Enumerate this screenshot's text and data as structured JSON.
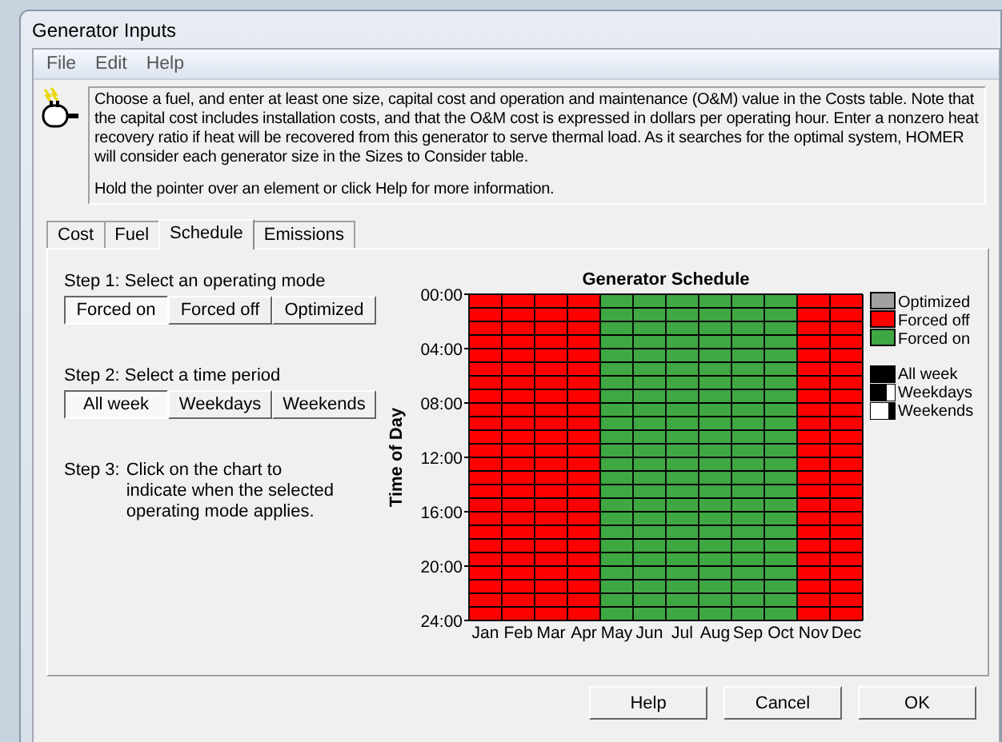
{
  "window": {
    "title": "Generator Inputs"
  },
  "menu": [
    "File",
    "Edit",
    "Help"
  ],
  "description": [
    "Choose a fuel, and enter at least one size, capital cost and operation and maintenance (O&M) value in the Costs table. Note that the capital cost includes installation costs, and that the O&M cost is expressed in dollars per operating hour. Enter a nonzero heat recovery ratio if heat will be recovered from this generator to serve thermal load. As it searches for the optimal system, HOMER will consider each generator size in the Sizes to Consider table.",
    "Hold the pointer over an element or click Help for more information."
  ],
  "tabs": [
    {
      "label": "Cost",
      "selected": false
    },
    {
      "label": "Fuel",
      "selected": false
    },
    {
      "label": "Schedule",
      "selected": true
    },
    {
      "label": "Emissions",
      "selected": false
    }
  ],
  "steps": [
    {
      "label": "Step 1:  Select an operating mode",
      "options": [
        {
          "label": "Forced on",
          "selected": true
        },
        {
          "label": "Forced off",
          "selected": false
        },
        {
          "label": "Optimized",
          "selected": false
        }
      ]
    },
    {
      "label": "Step 2:  Select a time period",
      "options": [
        {
          "label": "All week",
          "selected": true
        },
        {
          "label": "Weekdays",
          "selected": false
        },
        {
          "label": "Weekends",
          "selected": false
        }
      ]
    },
    {
      "label": "Step 3:",
      "text": "Click on the chart to indicate when the selected operating mode applies."
    }
  ],
  "schedule": {
    "title": "Generator Schedule",
    "ylabel": "Time of Day",
    "hour_ticks": [
      "00:00",
      "04:00",
      "08:00",
      "12:00",
      "16:00",
      "20:00",
      "24:00"
    ],
    "months": [
      {
        "label": "Jan",
        "color": "#ff0000"
      },
      {
        "label": "Feb",
        "color": "#ff0000"
      },
      {
        "label": "Mar",
        "color": "#ff0000"
      },
      {
        "label": "Apr",
        "color": "#ff0000"
      },
      {
        "label": "May",
        "color": "#3fa843"
      },
      {
        "label": "Jun",
        "color": "#3fa843"
      },
      {
        "label": "Jul",
        "color": "#3fa843"
      },
      {
        "label": "Aug",
        "color": "#3fa843"
      },
      {
        "label": "Sep",
        "color": "#3fa843"
      },
      {
        "label": "Oct",
        "color": "#3fa843"
      },
      {
        "label": "Nov",
        "color": "#ff0000"
      },
      {
        "label": "Dec",
        "color": "#ff0000"
      }
    ],
    "modes": [
      {
        "label": "Optimized",
        "color": "#a0a0a0"
      },
      {
        "label": "Forced off",
        "color": "#ff0000"
      },
      {
        "label": "Forced on",
        "color": "#3fa843"
      }
    ],
    "periods": [
      {
        "label": "All week",
        "kind": "all"
      },
      {
        "label": "Weekdays",
        "kind": "weekdays"
      },
      {
        "label": "Weekends",
        "kind": "weekends"
      }
    ]
  },
  "buttons": [
    "Help",
    "Cancel",
    "OK"
  ]
}
